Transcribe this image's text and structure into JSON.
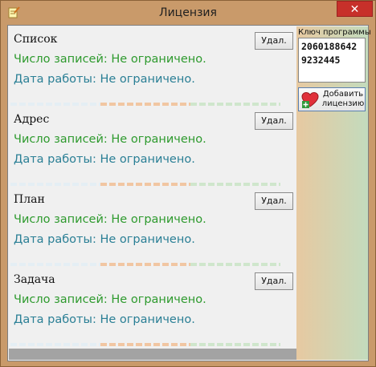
{
  "window": {
    "title": "Лицензия",
    "close_glyph": "✕"
  },
  "sections": [
    {
      "title": "Список",
      "delete_label": "Удал.",
      "records": "Число записей: Не ограничено.",
      "work_date": "Дата работы: Не ограничено."
    },
    {
      "title": "Адрес",
      "delete_label": "Удал.",
      "records": "Число записей: Не ограничено.",
      "work_date": "Дата работы: Не ограничено."
    },
    {
      "title": "План",
      "delete_label": "Удал.",
      "records": "Число записей: Не ограничено.",
      "work_date": "Дата работы: Не ограничено."
    },
    {
      "title": "Задача",
      "delete_label": "Удал.",
      "records": "Число записей: Не ограничено.",
      "work_date": "Дата работы: Не ограничено."
    }
  ],
  "sidebar": {
    "key_label": "Ключ программы",
    "key_line1": "2060188642",
    "key_line2": "9232445",
    "add_license_line1": "Добавить",
    "add_license_line2": "лицензию"
  },
  "colors": {
    "records_text": "#2e9a2e",
    "date_text": "#2a7f95",
    "separator_light": "#e4eef4",
    "separator_orange": "#f1c6a2",
    "separator_green": "#cfe6cc",
    "close_button": "#c7302a"
  },
  "icons": {
    "title": "notepad-pencil-icon",
    "add_license": "heart-plus-icon"
  }
}
